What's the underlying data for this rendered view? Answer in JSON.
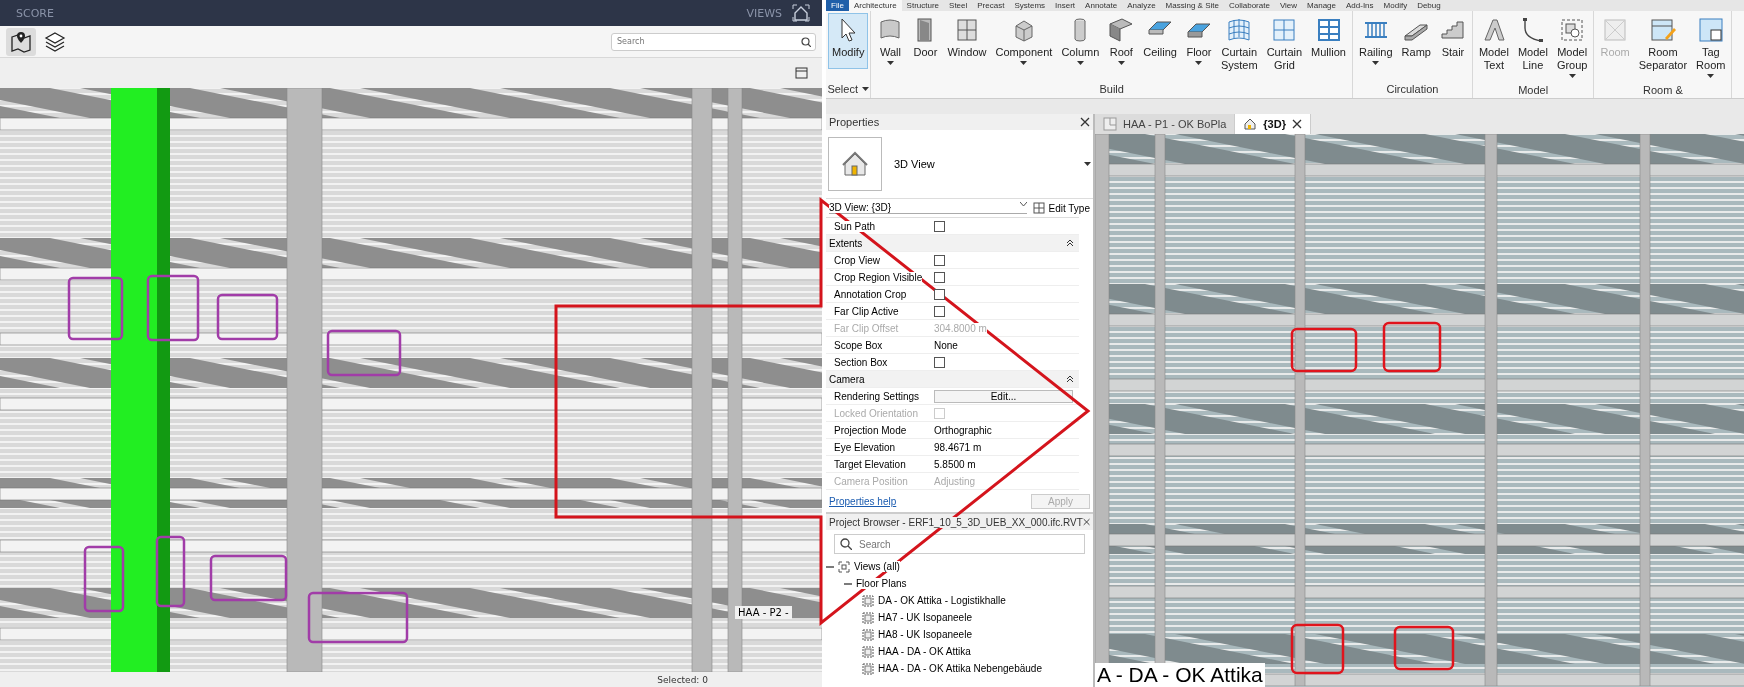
{
  "score_app": {
    "header": {
      "title": "SCORE",
      "views_label": "VIEWS"
    },
    "toolbar": {
      "tools": [
        {
          "kind": "map",
          "selected": true
        },
        {
          "kind": "layers",
          "selected": false
        }
      ],
      "search": {
        "placeholder": "Search"
      }
    },
    "viewport": {
      "view_label": "HAA - P2 -"
    },
    "status_bar": {
      "text": "Selected: 0"
    }
  },
  "ribbon": {
    "tabs": [
      {
        "kind": "menu",
        "label": "File",
        "selected": false
      },
      {
        "kind": "tab",
        "label": "Architecture",
        "selected": true
      },
      {
        "kind": "tab",
        "label": "Structure",
        "selected": false
      },
      {
        "kind": "tab",
        "label": "Steel",
        "selected": false
      },
      {
        "kind": "tab",
        "label": "Precast",
        "selected": false
      },
      {
        "kind": "tab",
        "label": "Systems",
        "selected": false
      },
      {
        "kind": "tab",
        "label": "Insert",
        "selected": false
      },
      {
        "kind": "tab",
        "label": "Annotate",
        "selected": false
      },
      {
        "kind": "tab",
        "label": "Analyze",
        "selected": false
      },
      {
        "kind": "tab",
        "label": "Massing & Site",
        "selected": false
      },
      {
        "kind": "tab",
        "label": "Collaborate",
        "selected": false
      },
      {
        "kind": "tab",
        "label": "View",
        "selected": false
      },
      {
        "kind": "tab",
        "label": "Manage",
        "selected": false
      },
      {
        "kind": "tab",
        "label": "Add-Ins",
        "selected": false
      },
      {
        "kind": "tab",
        "label": "Modify",
        "selected": false
      },
      {
        "kind": "tab",
        "label": "Debug",
        "selected": false
      }
    ],
    "panels": [
      {
        "title": "Select",
        "dropdown": true,
        "tools": [
          {
            "kind": "modify",
            "label": "Modify",
            "dropdown": false,
            "selected": true,
            "disabled": false
          }
        ]
      },
      {
        "title": "Build",
        "dropdown": false,
        "tools": [
          {
            "kind": "wall",
            "label": "Wall",
            "dropdown": true,
            "selected": false,
            "disabled": false
          },
          {
            "kind": "door",
            "label": "Door",
            "dropdown": false,
            "selected": false,
            "disabled": false
          },
          {
            "kind": "window",
            "label": "Window",
            "dropdown": false,
            "selected": false,
            "disabled": false
          },
          {
            "kind": "component",
            "label": "Component",
            "dropdown": true,
            "selected": false,
            "disabled": false
          },
          {
            "kind": "column",
            "label": "Column",
            "dropdown": true,
            "selected": false,
            "disabled": false
          },
          {
            "kind": "roof",
            "label": "Roof",
            "dropdown": true,
            "selected": false,
            "disabled": false
          },
          {
            "kind": "ceiling",
            "label": "Ceiling",
            "dropdown": false,
            "selected": false,
            "disabled": false
          },
          {
            "kind": "floor",
            "label": "Floor",
            "dropdown": true,
            "selected": false,
            "disabled": false
          },
          {
            "kind": "curtain_system",
            "label": "Curtain System",
            "dropdown": false,
            "selected": false,
            "disabled": false
          },
          {
            "kind": "curtain_grid",
            "label": "Curtain Grid",
            "dropdown": false,
            "selected": false,
            "disabled": false
          },
          {
            "kind": "mullion",
            "label": "Mullion",
            "dropdown": false,
            "selected": false,
            "disabled": false
          }
        ]
      },
      {
        "title": "Circulation",
        "dropdown": false,
        "tools": [
          {
            "kind": "railing",
            "label": "Railing",
            "dropdown": true,
            "selected": false,
            "disabled": false
          },
          {
            "kind": "ramp",
            "label": "Ramp",
            "dropdown": false,
            "selected": false,
            "disabled": false
          },
          {
            "kind": "stair",
            "label": "Stair",
            "dropdown": false,
            "selected": false,
            "disabled": false
          }
        ]
      },
      {
        "title": "Model",
        "dropdown": false,
        "tools": [
          {
            "kind": "model_text",
            "label": "Model Text",
            "dropdown": false,
            "selected": false,
            "disabled": false
          },
          {
            "kind": "model_line",
            "label": "Model Line",
            "dropdown": false,
            "selected": false,
            "disabled": false
          },
          {
            "kind": "model_group",
            "label": "Model Group",
            "dropdown": true,
            "selected": false,
            "disabled": false
          }
        ]
      },
      {
        "title": "Room &",
        "dropdown": false,
        "tools": [
          {
            "kind": "room",
            "label": "Room",
            "dropdown": false,
            "selected": false,
            "disabled": true
          },
          {
            "kind": "room_separator",
            "label": "Room Separator",
            "dropdown": false,
            "selected": false,
            "disabled": false
          },
          {
            "kind": "tag_room",
            "label": "Tag Room",
            "dropdown": true,
            "selected": false,
            "disabled": false
          }
        ]
      }
    ]
  },
  "properties": {
    "title": "Properties",
    "type_name": "3D View",
    "instance": "3D View: {3D}",
    "edit_type": "Edit Type",
    "rows": [
      {
        "kind": "checkbox",
        "label": "Sun Path",
        "checked": false,
        "disabled": false
      },
      {
        "kind": "group",
        "label": "Extents",
        "expanded": true
      },
      {
        "kind": "checkbox",
        "label": "Crop View",
        "checked": false,
        "disabled": false
      },
      {
        "kind": "checkbox",
        "label": "Crop Region Visible",
        "checked": false,
        "disabled": false
      },
      {
        "kind": "checkbox",
        "label": "Annotation Crop",
        "checked": false,
        "disabled": false
      },
      {
        "kind": "checkbox",
        "label": "Far Clip Active",
        "checked": false,
        "disabled": false
      },
      {
        "kind": "value",
        "label": "Far Clip Offset",
        "value": "304.8000 m",
        "disabled": true
      },
      {
        "kind": "value",
        "label": "Scope Box",
        "value": "None",
        "disabled": false
      },
      {
        "kind": "checkbox",
        "label": "Section Box",
        "checked": false,
        "disabled": false
      },
      {
        "kind": "group",
        "label": "Camera",
        "expanded": true
      },
      {
        "kind": "button",
        "label": "Rendering Settings",
        "value": "Edit...",
        "disabled": false
      },
      {
        "kind": "checkbox",
        "label": "Locked Orientation",
        "checked": false,
        "disabled": true
      },
      {
        "kind": "value",
        "label": "Projection Mode",
        "value": "Orthographic",
        "disabled": false
      },
      {
        "kind": "value",
        "label": "Eye Elevation",
        "value": "98.4671 m",
        "disabled": false
      },
      {
        "kind": "value",
        "label": "Target Elevation",
        "value": "5.8500 m",
        "disabled": false
      },
      {
        "kind": "value",
        "label": "Camera Position",
        "value": "Adjusting",
        "disabled": true
      }
    ],
    "help_link": "Properties help",
    "apply": {
      "label": "Apply",
      "disabled": true
    }
  },
  "project_browser": {
    "title": "Project Browser - ERF1_10_5_3D_UEB_XX_000.ifc.RVT",
    "search": {
      "placeholder": "Search"
    },
    "tree": [
      {
        "label": "Views (all)",
        "expanded": true,
        "children": [
          {
            "label": "Floor Plans",
            "expanded": true,
            "children": [
              {
                "label": "DA - OK Attika - Logistikhalle"
              },
              {
                "label": "HA7 - UK Isopaneele"
              },
              {
                "label": "HA8 - UK Isopaneele"
              },
              {
                "label": "HAA - DA - OK Attika"
              },
              {
                "label": "HAA - DA - OK Attika Nebengebäude"
              }
            ]
          }
        ]
      }
    ]
  },
  "view_tabs": [
    {
      "kind": "plan",
      "label": "HAA - P1 - OK BoPla",
      "selected": false
    },
    {
      "kind": "isometric",
      "label": "{3D}",
      "selected": true
    }
  ],
  "model_view": {
    "level_label": "A - DA - OK Attika"
  }
}
